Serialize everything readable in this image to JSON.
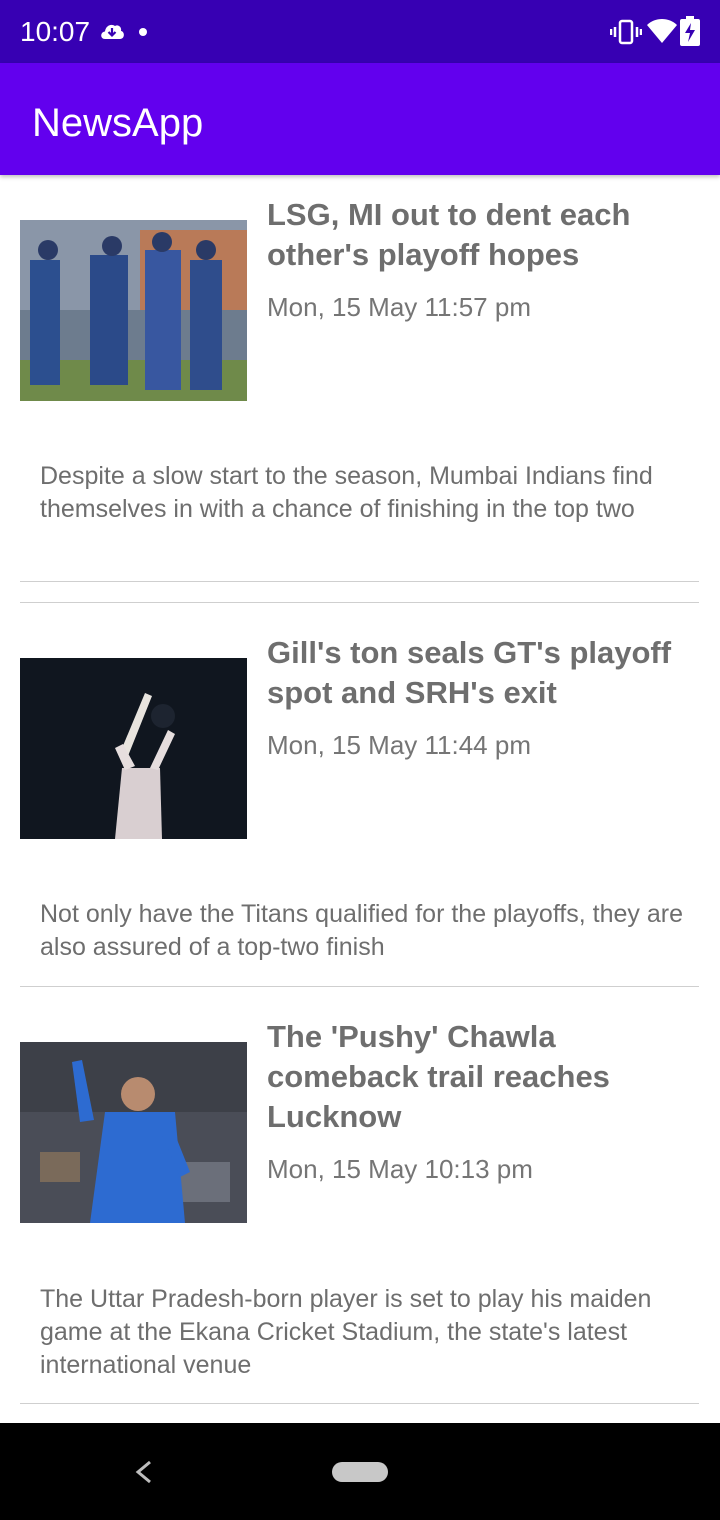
{
  "status_bar": {
    "time": "10:07",
    "icons": [
      "cloud-download-icon",
      "notification-dot-icon",
      "vibrate-icon",
      "wifi-icon",
      "battery-charging-icon"
    ]
  },
  "app_bar": {
    "title": "NewsApp",
    "color": "#6200ee"
  },
  "colors": {
    "status_bar": "#3700b3",
    "primary": "#6200ee",
    "text": "#6e6e6e"
  },
  "articles": [
    {
      "headline": "LSG, MI out to dent each other's playoff hopes",
      "date": "Mon, 15 May 11:57 pm",
      "summary": "Despite a slow start to the season, Mumbai Indians find themselves in with a chance of finishing in the top two"
    },
    {
      "headline": "Gill's ton seals GT's playoff spot and SRH's exit",
      "date": "Mon, 15 May 11:44 pm",
      "summary": "Not only have the Titans qualified for the playoffs, they are also assured of a top-two finish"
    },
    {
      "headline": "The 'Pushy' Chawla comeback trail reaches Lucknow",
      "date": "Mon, 15 May 10:13 pm",
      "summary": "The Uttar Pradesh-born player is set to play his maiden game at the Ekana Cricket Stadium, the state's latest international venue"
    }
  ],
  "nav_bar": {
    "icons": [
      "back-icon",
      "home-pill-icon"
    ]
  }
}
